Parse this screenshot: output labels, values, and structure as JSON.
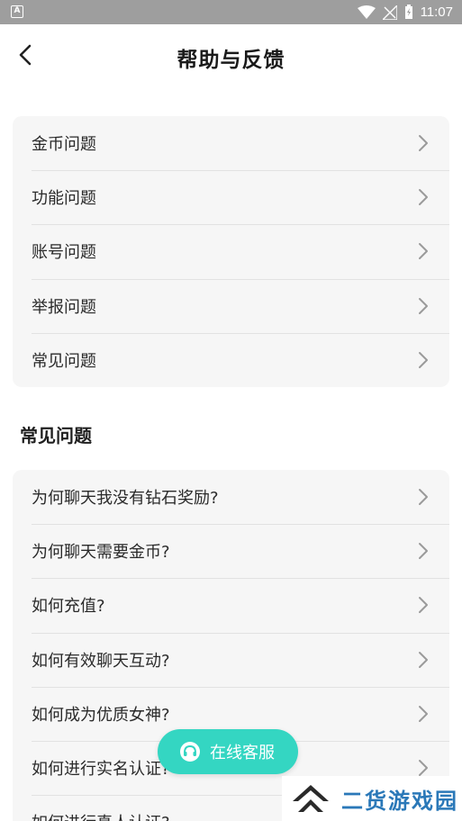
{
  "status_bar": {
    "left_icon": "A",
    "time": "11:07"
  },
  "header": {
    "title": "帮助与反馈",
    "back_icon": "chevron-left"
  },
  "categories": {
    "items": [
      {
        "label": "金币问题"
      },
      {
        "label": "功能问题"
      },
      {
        "label": "账号问题"
      },
      {
        "label": "举报问题"
      },
      {
        "label": "常见问题"
      }
    ]
  },
  "faq": {
    "title": "常见问题",
    "items": [
      {
        "label": "为何聊天我没有钻石奖励?"
      },
      {
        "label": "为何聊天需要金币?"
      },
      {
        "label": "如何充值?"
      },
      {
        "label": "如何有效聊天互动?"
      },
      {
        "label": "如何成为优质女神?"
      },
      {
        "label": "如何进行实名认证?"
      },
      {
        "label": "如何进行真人认证?"
      }
    ]
  },
  "service_button": {
    "label": "在线客服",
    "color": "#34d6c2"
  },
  "watermark": {
    "text": "二货游戏园"
  }
}
